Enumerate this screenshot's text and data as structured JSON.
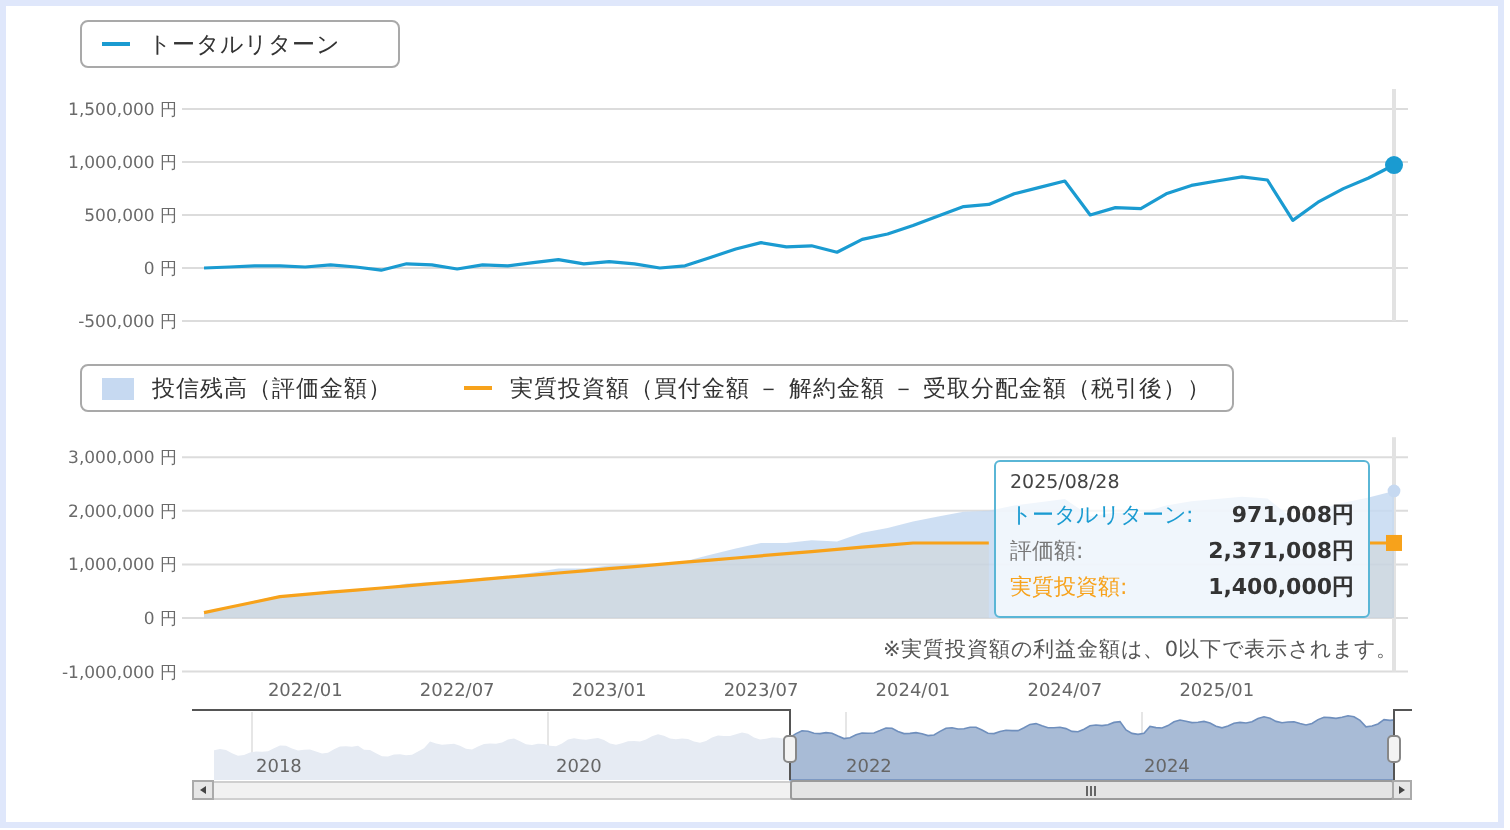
{
  "top_chart": {
    "legend": [
      {
        "kind": "line"
      }
    ],
    "chart_data": {
      "type": "line",
      "grid": true,
      "ylim": [
        -500000,
        1500000
      ],
      "yticks": [
        {
          "value": 1500000,
          "label": "1,500,000 円"
        },
        {
          "value": 1000000,
          "label": "1,000,000 円"
        },
        {
          "value": 500000,
          "label": "500,000 円"
        },
        {
          "value": 0,
          "label": "0 円"
        },
        {
          "value": -500000,
          "label": "-500,000 円"
        }
      ],
      "series": [
        {
          "name": "トータルリターン",
          "color": "#1a9bd1",
          "values": [
            0,
            10000,
            20000,
            20000,
            10000,
            30000,
            10000,
            -20000,
            40000,
            30000,
            -10000,
            30000,
            20000,
            50000,
            80000,
            40000,
            60000,
            40000,
            0,
            20000,
            100000,
            180000,
            240000,
            200000,
            210000,
            150000,
            270000,
            320000,
            400000,
            490000,
            580000,
            600000,
            700000,
            760000,
            820000,
            500000,
            570000,
            560000,
            700000,
            780000,
            820000,
            860000,
            830000,
            450000,
            620000,
            750000,
            850000,
            971008
          ]
        }
      ]
    }
  },
  "bottom_chart": {
    "legend": [
      {
        "kind": "area"
      },
      {
        "kind": "line"
      }
    ],
    "chart_data": {
      "type": "area",
      "grid": true,
      "categories": [
        null,
        null,
        null,
        null,
        "2022/01",
        null,
        null,
        null,
        null,
        null,
        "2022/07",
        null,
        null,
        null,
        null,
        null,
        "2023/01",
        null,
        null,
        null,
        null,
        null,
        "2023/07",
        null,
        null,
        null,
        null,
        null,
        "2024/01",
        null,
        null,
        null,
        null,
        null,
        "2024/07",
        null,
        null,
        null,
        null,
        null,
        "2025/01",
        null,
        null,
        null,
        null,
        null,
        null,
        null
      ],
      "ylim": [
        -1000000,
        3000000
      ],
      "yticks": [
        {
          "value": 3000000,
          "label": "3,000,000 円"
        },
        {
          "value": 2000000,
          "label": "2,000,000 円"
        },
        {
          "value": 1000000,
          "label": "1,000,000 円"
        },
        {
          "value": 0,
          "label": "0 円"
        },
        {
          "value": -1000000,
          "label": "-1,000,000 円"
        }
      ],
      "series": [
        {
          "name": "投信残高（評価金額）",
          "color": "#c6d9f1",
          "values": [
            100000,
            210000,
            320000,
            420000,
            450000,
            510000,
            530000,
            540000,
            640000,
            670000,
            670000,
            750000,
            780000,
            850000,
            920000,
            920000,
            980000,
            1000000,
            1000000,
            1060000,
            1180000,
            1300000,
            1400000,
            1400000,
            1450000,
            1430000,
            1590000,
            1680000,
            1800000,
            1890000,
            1980000,
            2000000,
            2100000,
            2160000,
            2220000,
            1900000,
            1970000,
            1960000,
            2100000,
            2180000,
            2220000,
            2260000,
            2230000,
            1850000,
            2020000,
            2150000,
            2250000,
            2371008
          ]
        },
        {
          "name": "実質投資額（買付金額 － 解約金額 － 受取分配金額（税引後））",
          "color": "#f7a21b",
          "values": [
            100000,
            200000,
            300000,
            400000,
            440000,
            480000,
            520000,
            560000,
            600000,
            640000,
            680000,
            720000,
            760000,
            800000,
            840000,
            880000,
            920000,
            960000,
            1000000,
            1040000,
            1080000,
            1120000,
            1160000,
            1200000,
            1240000,
            1280000,
            1320000,
            1360000,
            1400000,
            1400000,
            1400000,
            1400000,
            null,
            null,
            null,
            null,
            null,
            null,
            null,
            null,
            null,
            null,
            null,
            null,
            null,
            null,
            1400000,
            1400000
          ]
        }
      ]
    },
    "tooltip": {
      "date": "2025/08/28",
      "rows": [
        {
          "label": "トータルリターン:",
          "value": "971,008円",
          "color": "#1a9bd1"
        },
        {
          "label": "評価額:",
          "value": "2,371,008円",
          "color": "#777777"
        },
        {
          "label": "実質投資額:",
          "value": "1,400,000円",
          "color": "#f7a21b"
        }
      ]
    },
    "note": "※実質投資額の利益金額は、0以下で表示されます。"
  },
  "navigator": {
    "labels": [
      "2018",
      "2020",
      "2022",
      "2024"
    ]
  }
}
